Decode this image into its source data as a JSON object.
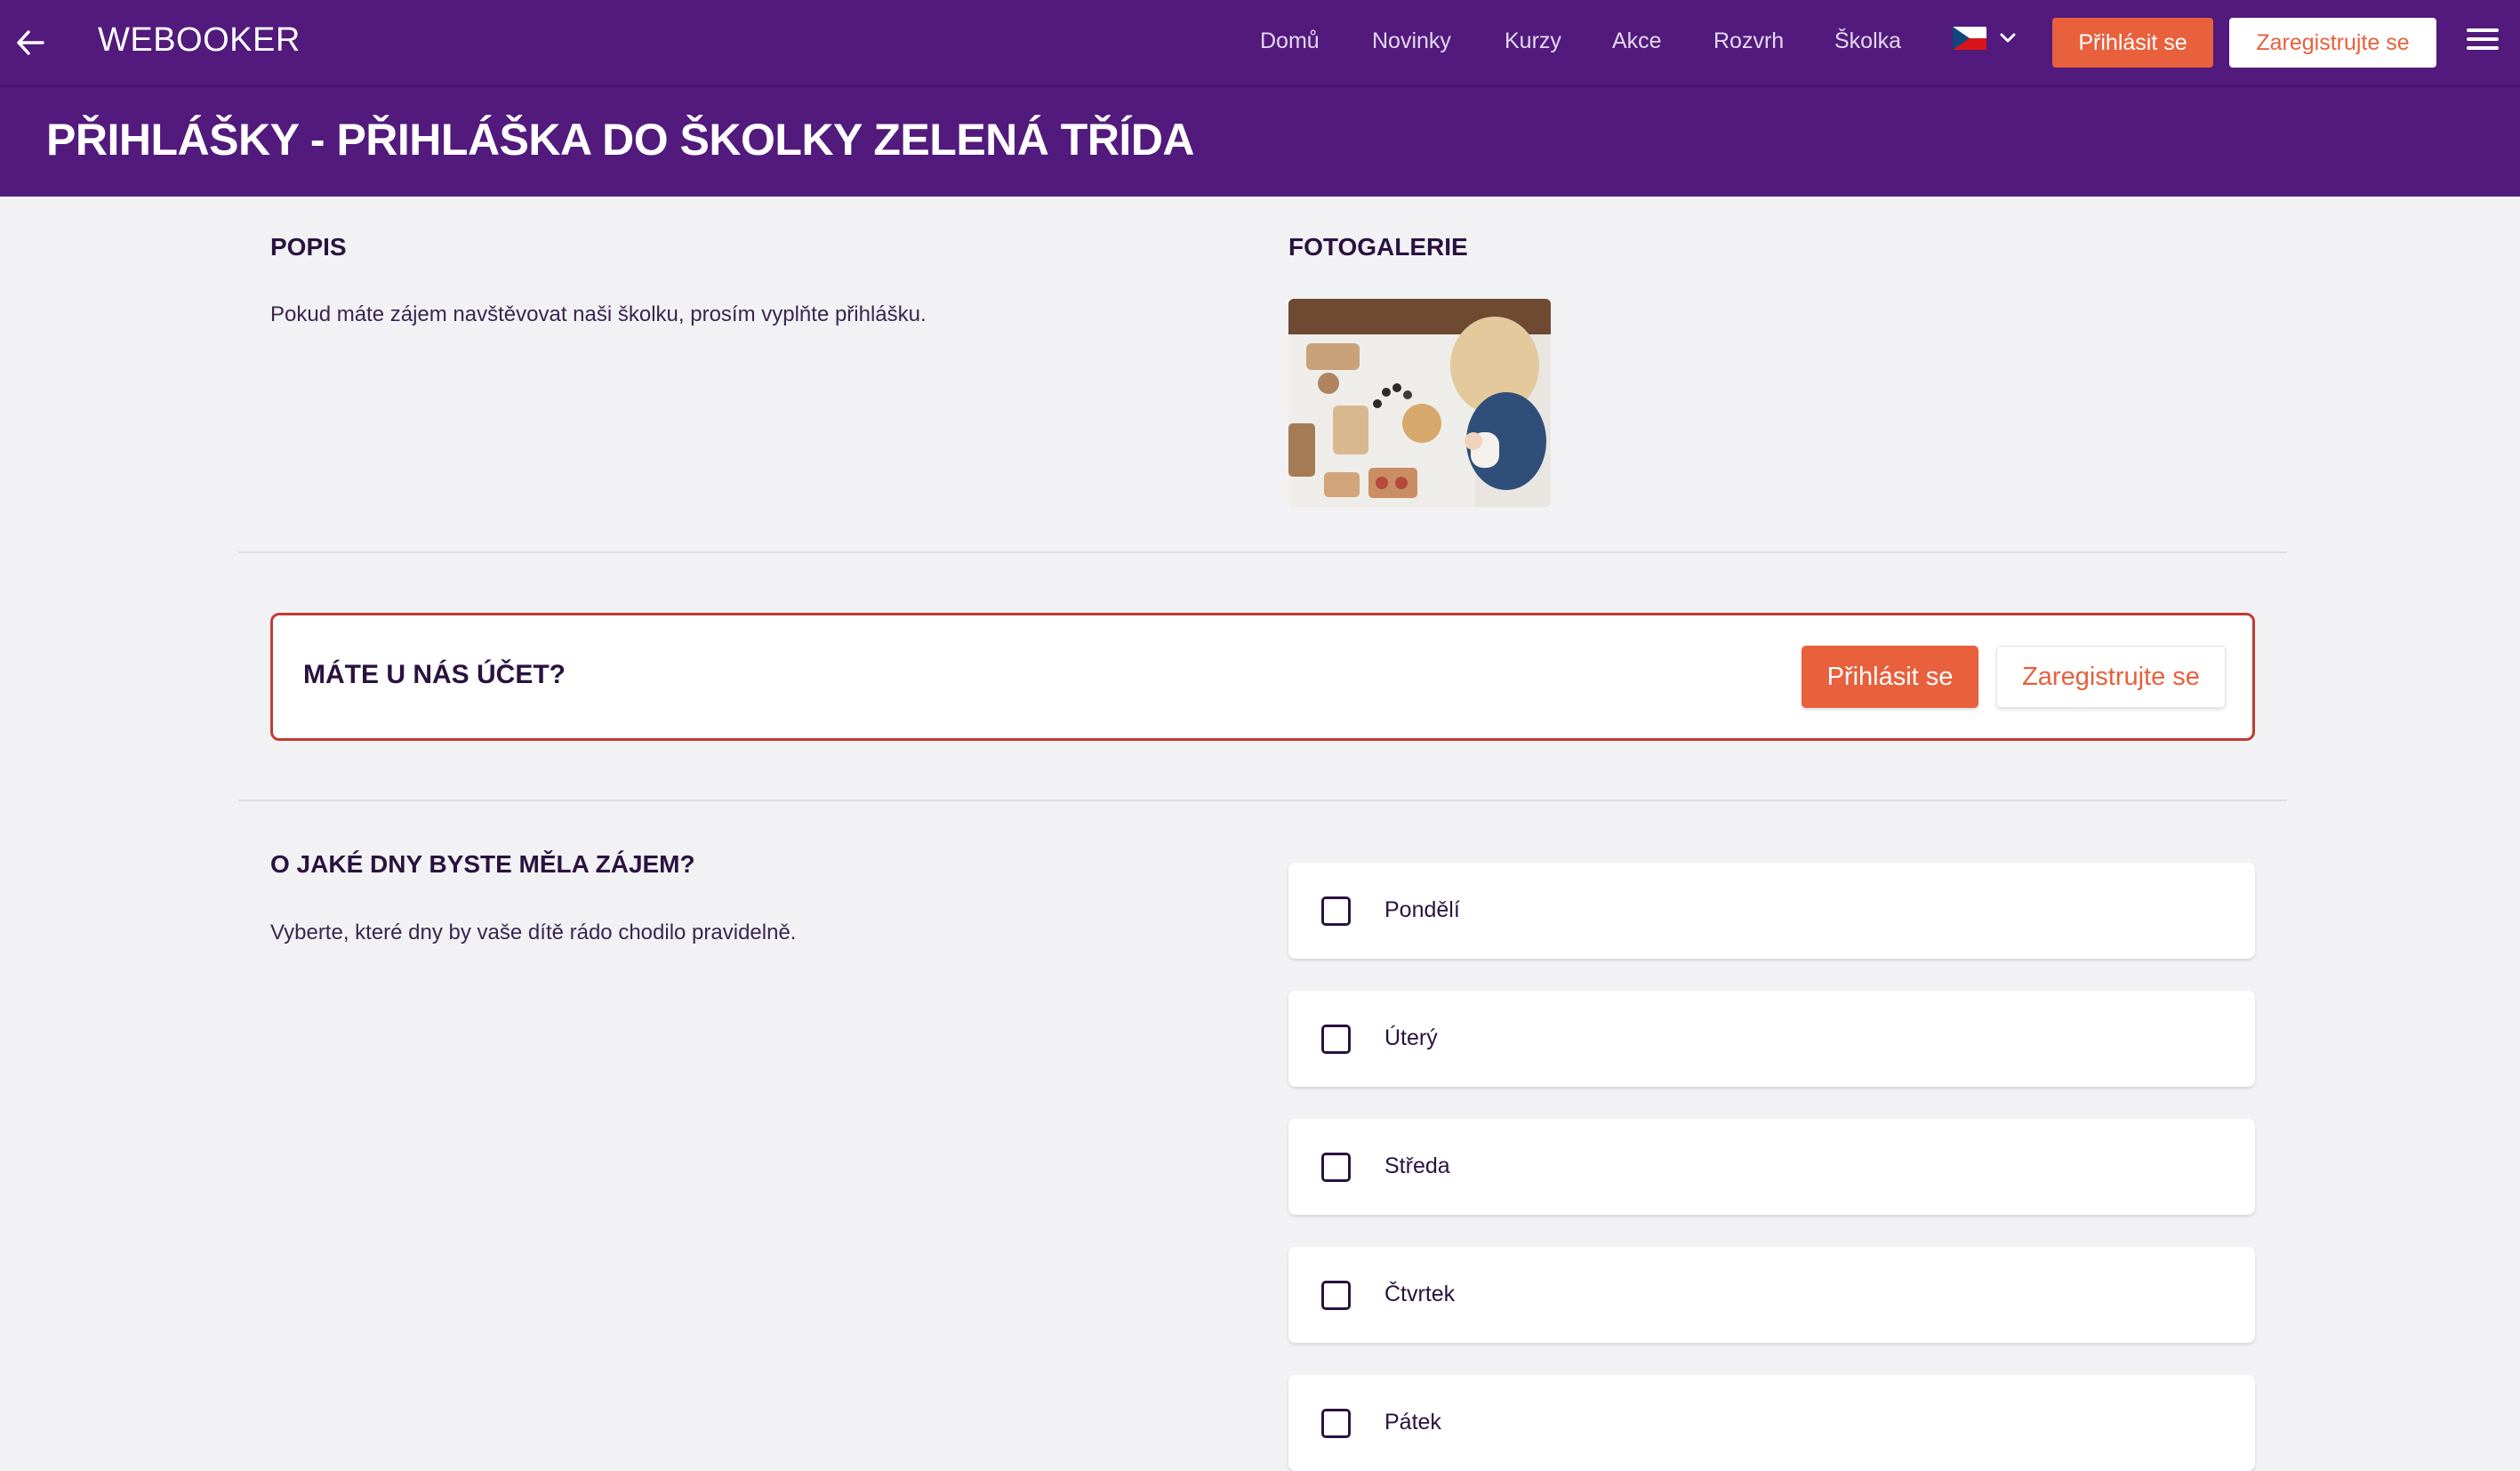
{
  "nav": {
    "brand": "WEBOOKER",
    "items": [
      "Domů",
      "Novinky",
      "Kurzy",
      "Akce",
      "Rozvrh",
      "Školka"
    ],
    "login_label": "Přihlásit se",
    "register_label": "Zaregistrujte se",
    "language_icon": "czech-flag-icon"
  },
  "page": {
    "title": "PŘIHLÁŠKY - PŘIHLÁŠKA DO ŠKOLKY ZELENÁ TŘÍDA"
  },
  "description": {
    "heading": "POPIS",
    "text": "Pokud máte zájem navštěvovat naši školku, prosím vyplňte přihlášku."
  },
  "gallery": {
    "heading": "FOTOGALERIE"
  },
  "account": {
    "question": "MÁTE U NÁS ÚČET?",
    "login_label": "Přihlásit se",
    "register_label": "Zaregistrujte se"
  },
  "days": {
    "heading": "O JAKÉ DNY BYSTE MĚLA ZÁJEM?",
    "hint": "Vyberte, které dny by vaše dítě rádo chodilo pravidelně.",
    "options": [
      "Pondělí",
      "Úterý",
      "Středa",
      "Čtvrtek",
      "Pátek"
    ]
  },
  "colors": {
    "primary": "#521a7c",
    "accent": "#e8603c",
    "alert_border": "#c43a34",
    "background": "#f2f2f4"
  }
}
